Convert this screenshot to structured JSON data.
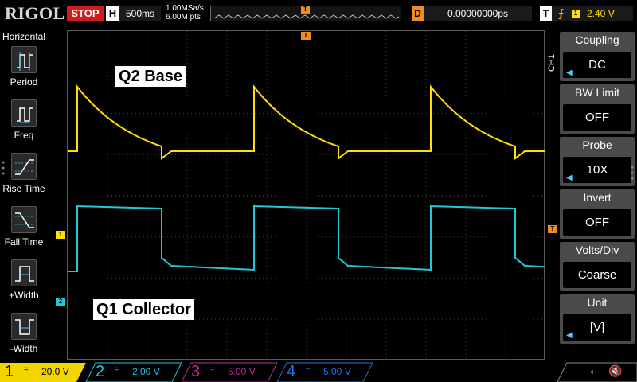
{
  "brand": "RIGOL",
  "run_state": "STOP",
  "horizontal": {
    "h_label": "H",
    "timebase": "500ms",
    "sample_rate": "1.00MSa/s",
    "points": "6.00M pts",
    "trigger_pos_marker": "T"
  },
  "delay": {
    "label": "D",
    "value": "0.00000000ps"
  },
  "trigger": {
    "label": "T",
    "edge_icon": "rising-edge-icon",
    "source": "1",
    "level": "2.40 V"
  },
  "left_menu": {
    "title": "Horizontal",
    "items": [
      {
        "label": "Period",
        "icon": "period-icon"
      },
      {
        "label": "Freq",
        "icon": "frequency-icon"
      },
      {
        "label": "Rise Time",
        "icon": "rise-time-icon"
      },
      {
        "label": "Fall Time",
        "icon": "fall-time-icon"
      },
      {
        "label": "+Width",
        "icon": "positive-width-icon"
      },
      {
        "label": "-Width",
        "icon": "negative-width-icon"
      }
    ]
  },
  "screen": {
    "label_top": "Q2 Base",
    "label_bottom": "Q1 Collector",
    "ch1_marker": "1",
    "ch2_marker": "2",
    "trigger_marker": "T",
    "trigger_level_marker": "T"
  },
  "right_menu": {
    "channel": "CH1",
    "items": [
      {
        "title": "Coupling",
        "value": "DC",
        "has_arrow": true
      },
      {
        "title": "BW Limit",
        "value": "OFF",
        "has_arrow": false
      },
      {
        "title": "Probe",
        "value": "10X",
        "has_arrow": true
      },
      {
        "title": "Invert",
        "value": "OFF",
        "has_arrow": false
      },
      {
        "title": "Volts/Div",
        "value": "Coarse",
        "has_arrow": false
      },
      {
        "title": "Unit",
        "value": "[V]",
        "has_arrow": true
      }
    ]
  },
  "channels": [
    {
      "num": "1",
      "coupling_icon": "dc-coupling-icon",
      "coupling_symbol": "=",
      "scale": "20.0 V",
      "color": "#ffe000",
      "active": true
    },
    {
      "num": "2",
      "coupling_icon": "dc-coupling-icon",
      "coupling_symbol": "=",
      "scale": "2.00 V",
      "color": "#22c8d8",
      "active": false
    },
    {
      "num": "3",
      "coupling_icon": "dc-coupling-icon",
      "coupling_symbol": "=",
      "scale": "5.00 V",
      "color": "#c02890",
      "active": false
    },
    {
      "num": "4",
      "coupling_icon": "ac-coupling-icon",
      "coupling_symbol": "~",
      "scale": "5.00 V",
      "color": "#1e6ee6",
      "active": false
    }
  ],
  "status_icons": [
    "usb-icon",
    "speaker-mute-icon"
  ],
  "colors": {
    "ch1": "#ffe000",
    "ch2": "#22c8d8",
    "trigger": "#f08c20",
    "stop": "#d01c1c",
    "panel": "#4a4a4a"
  }
}
